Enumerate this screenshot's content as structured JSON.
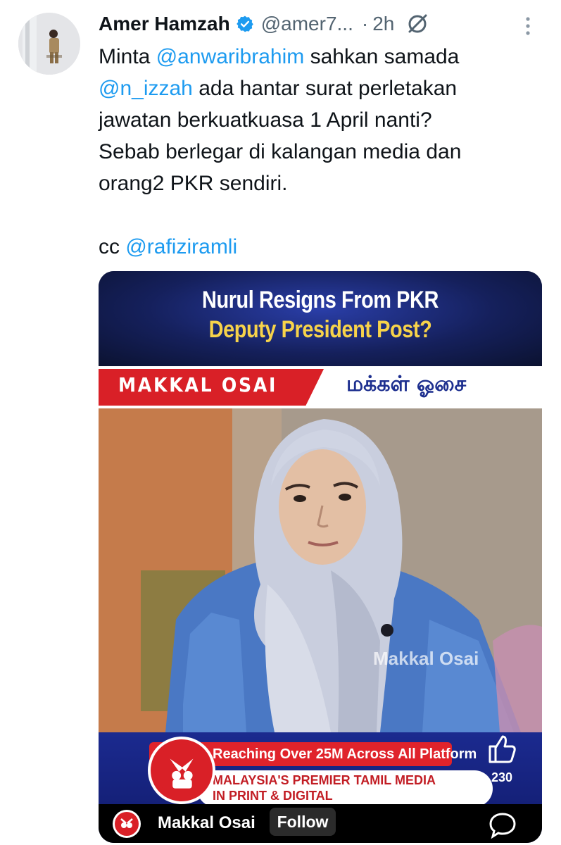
{
  "tweet": {
    "author_name": "Amer Hamzah",
    "handle": "@amer7...",
    "separator": "·",
    "time": "2h",
    "lines": [
      {
        "parts": [
          {
            "t": "Minta "
          },
          {
            "t": "@anwaribrahim",
            "m": true
          },
          {
            "t": " sahkan samada"
          }
        ]
      },
      {
        "parts": [
          {
            "t": "@n_izzah",
            "m": true
          },
          {
            "t": " ada hantar surat perletakan"
          }
        ]
      },
      {
        "parts": [
          {
            "t": "jawatan berkuatkuasa 1 April nanti?"
          }
        ]
      },
      {
        "parts": [
          {
            "t": "Sebab berlegar di kalangan media dan"
          }
        ]
      },
      {
        "parts": [
          {
            "t": "orang2 PKR sendiri."
          }
        ]
      },
      {
        "parts": [
          {
            "t": ""
          }
        ]
      },
      {
        "parts": [
          {
            "t": "cc "
          },
          {
            "t": "@rafiziramli",
            "m": true
          }
        ]
      }
    ]
  },
  "media": {
    "headline_line1": "Nurul Resigns From PKR",
    "headline_line2": "Deputy President Post?",
    "brand_latin": "MAKKAL OSAI",
    "brand_tamil": "மக்கள் ஓசை",
    "watermark": "Makkal Osai",
    "reach_text": "Reaching Over 25M Across All Platform",
    "premier_line1": "MALAYSIA'S PREMIER TAMIL MEDIA",
    "premier_line2": "IN PRINT & DIGITAL",
    "like_count": "230",
    "channel_name": "Makkal Osai",
    "follow_label": "Follow"
  },
  "colors": {
    "mention": "#1d9bf0",
    "verified": "#1d9bf0",
    "secondary_text": "#536471",
    "headline_yellow": "#f7d34a",
    "brand_red": "#d92027",
    "bar_blue": "#1b2a8f"
  },
  "icons": {
    "verified": "verified-badge-icon",
    "grok": "grok-icon",
    "more": "more-vertical-icon",
    "like": "thumbs-up-icon",
    "comment": "comment-bubble-icon"
  }
}
